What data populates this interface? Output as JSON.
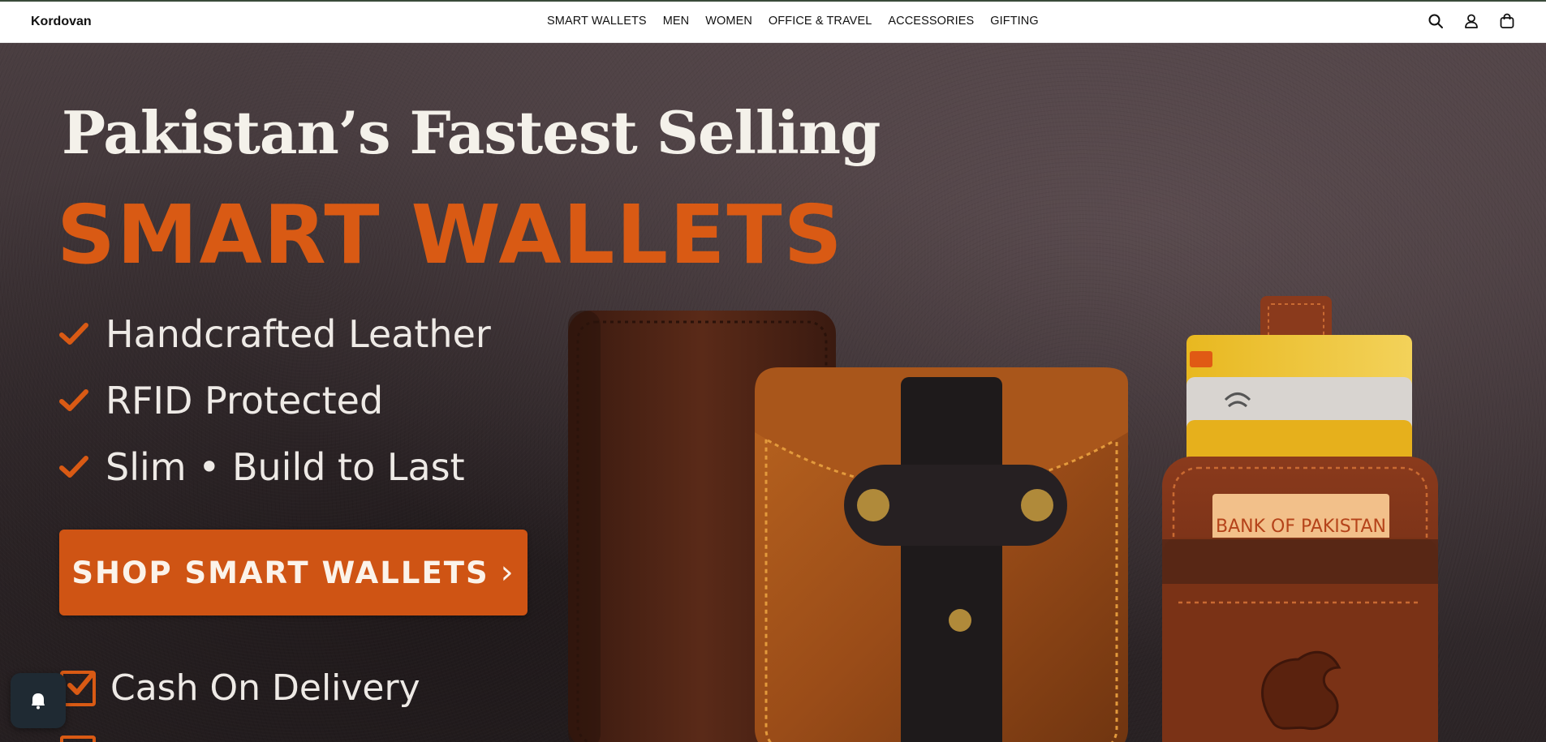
{
  "brand": {
    "name": "Kordovan"
  },
  "nav": {
    "items": [
      {
        "label": "SMART WALLETS"
      },
      {
        "label": "MEN"
      },
      {
        "label": "WOMEN"
      },
      {
        "label": "OFFICE & TRAVEL"
      },
      {
        "label": "ACCESSORIES"
      },
      {
        "label": "GIFTING"
      }
    ]
  },
  "header_icons": [
    "search-icon",
    "account-icon",
    "cart-icon"
  ],
  "hero": {
    "headline": "Pakistan’s Fastest Selling",
    "highlight": "SMART WALLETS",
    "bullets": [
      {
        "text": "Handcrafted Leather"
      },
      {
        "text": "RFID Protected"
      },
      {
        "text": "Slim • Build to Last"
      }
    ],
    "cta_label": "SHOP SMART WALLETS",
    "cta_chevron": "›",
    "cod_text": "Cash On Delivery",
    "card_label": "BANK OF PAKISTAN"
  },
  "colors": {
    "accent": "#d95a14",
    "cta_bg": "#cf5414",
    "hero_text": "#eeeae6",
    "header_bg": "#ffffff"
  },
  "chat_widget": {
    "icon": "chat-bubble-icon"
  }
}
